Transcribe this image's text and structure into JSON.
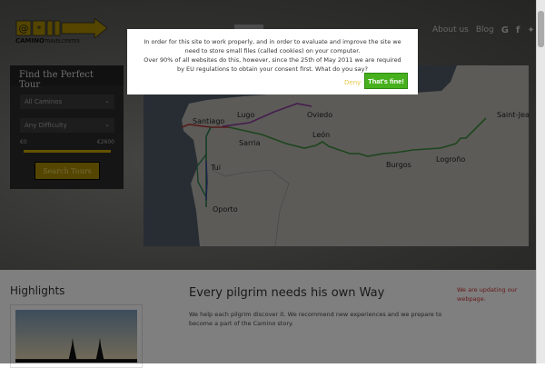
{
  "header": {
    "logo_text_bold": "CAMINO",
    "logo_text_rest": "TRAVELCENTER",
    "nav": [
      {
        "label": "About us"
      },
      {
        "label": "Blog"
      }
    ],
    "social": [
      "google-icon",
      "facebook-icon",
      "twitter-icon"
    ]
  },
  "finder": {
    "title": "Find the Perfect Tour",
    "camino_select": "All Caminos",
    "difficulty_select": "Any Difficulty",
    "price_min": "€0",
    "price_max": "€2600",
    "price_fill": 1.0,
    "search_label": "Search Tours"
  },
  "map": {
    "cities": [
      "Santiago",
      "Lugo",
      "Oviedo",
      "León",
      "Sarria",
      "Burgos",
      "Logroño",
      "Saint-Jea",
      "Tui",
      "Oporto"
    ]
  },
  "content": {
    "highlights_title": "Highlights",
    "headline": "Every pilgrim needs his own Way",
    "lead": "We help each pilgrim discover it. We recommend new experiences and we prepare to become a part of the Camino story.",
    "note": "We are updating our webpage."
  },
  "cookie": {
    "line1": "In order for this site to work properly, and in order to evaluate and improve the site we need to store small files (called cookies) on your computer.",
    "line2": "Over 90% of all websites do this, however, since the 25th of May 2011 we are required by EU regulations to obtain your consent first. What do you say?",
    "deny_label": "Deny",
    "accept_label": "That's fine!"
  },
  "colors": {
    "accent": "#a98b00",
    "accept": "#46b01d",
    "note": "#cc3333"
  }
}
